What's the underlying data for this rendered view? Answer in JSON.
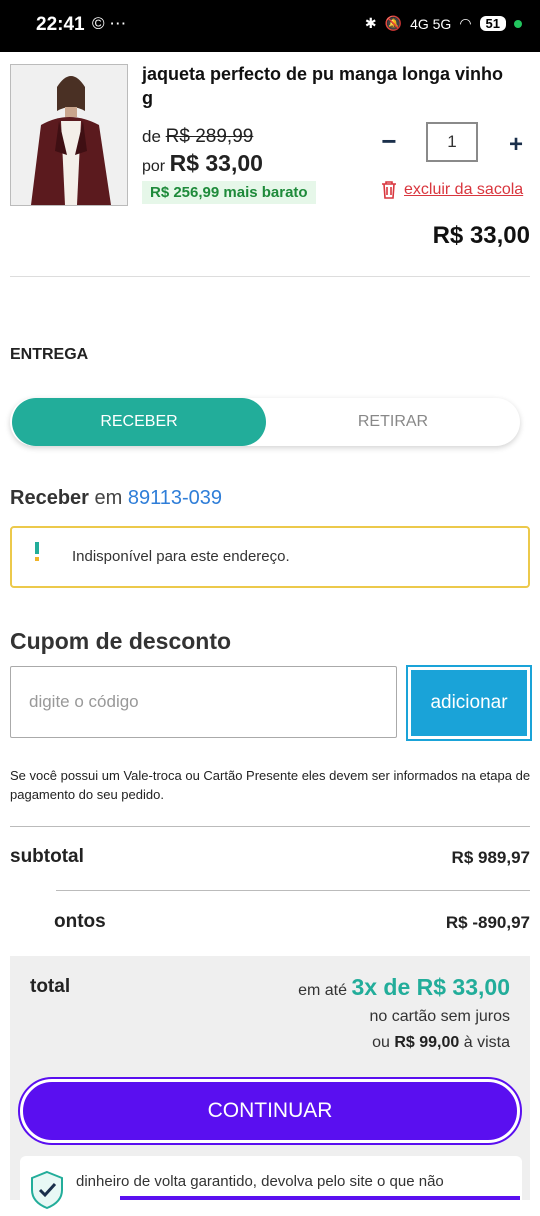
{
  "status_bar": {
    "time": "22:41",
    "left_icons": "© ⋯",
    "network": "4G 5G",
    "battery": "51"
  },
  "product": {
    "title": "jaqueta perfecto de pu manga longa vinho g",
    "old_price_prefix": "de",
    "old_price": "R$ 289,99",
    "new_price_prefix": "por",
    "new_price": "R$ 33,00",
    "savings": "R$ 256,99 mais barato",
    "quantity": "1",
    "minus_label": "−",
    "plus_label": "+",
    "remove_label": "excluir da sacola",
    "line_total": "R$ 33,00"
  },
  "delivery": {
    "section_title": "ENTREGA",
    "tab_receive": "RECEBER",
    "tab_pickup": "RETIRAR",
    "receive_label": "Receber",
    "receive_in": "em",
    "cep": "89113-039",
    "warning_text": "Indisponível para este endereço."
  },
  "coupon": {
    "title": "Cupom de desconto",
    "placeholder": "digite o código",
    "button_label": "adicionar",
    "gift_card_note": "Se você possui um Vale-troca ou Cartão Presente eles devem ser informados na etapa de pagamento do seu pedido."
  },
  "summary": {
    "subtotal_label": "subtotal",
    "subtotal_value": "R$ 989,97",
    "discount_label": "ontos",
    "discount_value": "R$ -890,97",
    "total_label": "total",
    "installments_prefix": "em até",
    "installments": "3x de R$ 33,00",
    "installments_note": "no cartão sem juros",
    "cash_prefix": "ou",
    "cash_value": "R$ 99,00",
    "cash_suffix": "à vista"
  },
  "continue_label": "CONTINUAR",
  "guarantee_text": "dinheiro de volta garantido, devolva pelo site o que não",
  "colors": {
    "accent_teal": "#22ad9a",
    "button_blue": "#1aa3d8",
    "continue_purple": "#5a0ff0",
    "remove_red": "#d9363e",
    "cep_blue": "#2f7ed8"
  }
}
